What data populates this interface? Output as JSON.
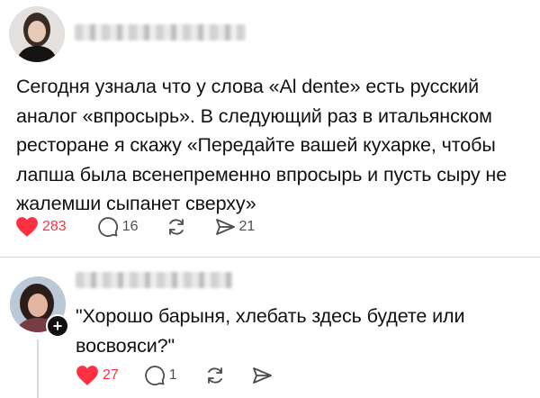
{
  "post": {
    "text": "Сегодня узнала что у слова «Al dente» есть русский\nаналог «впросырь». В следующий раз в итальянском\nресторане я скажу «Передайте вашей кухарке, чтобы\nлапша была всенепременно впросырь и пусть сыру не\nжалемши сыпанет сверху»",
    "likes": "283",
    "comments": "16",
    "shares": "21"
  },
  "reply": {
    "text": "\"Хорошо барыня, хлебать здесь будете или\nвосвояси?\"",
    "likes": "27",
    "comments": "1",
    "follow_label": "+"
  },
  "colors": {
    "like": "#ff3040",
    "icon": "#4d4d4d",
    "divider": "#d8d8d8"
  },
  "icons": {
    "like": "heart-icon",
    "comment": "comment-bubble-icon",
    "repost": "repost-icon",
    "share": "send-icon"
  }
}
